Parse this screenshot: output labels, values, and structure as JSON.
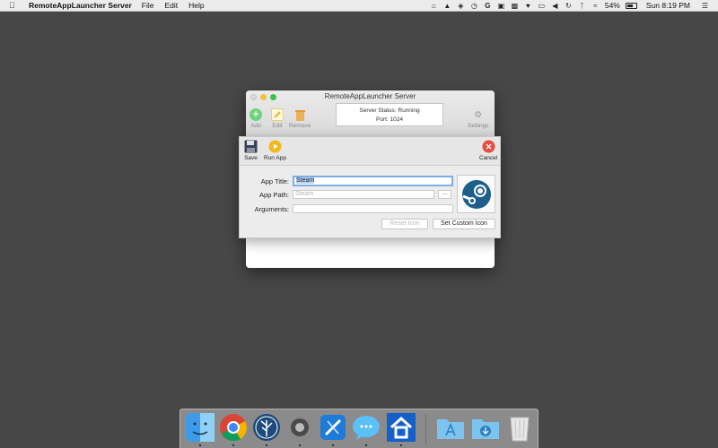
{
  "menubar": {
    "app_name": "RemoteAppLauncher Server",
    "menus": [
      "File",
      "Edit",
      "Help"
    ],
    "battery_percent": "54%",
    "clock": "Sun 8:19 PM"
  },
  "window": {
    "title": "RemoteAppLauncher Server",
    "toolbar": {
      "add_label": "Add",
      "edit_label": "Edit",
      "remove_label": "Remove",
      "settings_label": "Settings"
    },
    "status": {
      "line1": "Server Status: Running",
      "line2": "Port: 1024"
    }
  },
  "panel": {
    "save_label": "Save",
    "run_label": "Run App",
    "cancel_label": "Cancel",
    "app_title_label": "App Title:",
    "app_title_value": "Steam",
    "app_path_label": "App Path:",
    "app_path_placeholder": "Steam",
    "arguments_label": "Arguments:",
    "arguments_value": "",
    "browse_label": "...",
    "reset_icon_label": "Reset Icon",
    "set_icon_label": "Set Custom Icon"
  },
  "dock": {
    "apps": [
      "finder-icon",
      "chrome-icon",
      "sourcetree-icon",
      "system-preferences-icon",
      "xcode-icon",
      "messages-icon",
      "remote-app-launcher-icon"
    ],
    "stacks": [
      "applications-folder-icon",
      "downloads-folder-icon",
      "trash-icon"
    ]
  },
  "colors": {
    "desktop": "#474747",
    "add_green": "#45c35a",
    "run_yellow": "#f2b91c",
    "cancel_red": "#e74c3c",
    "focus_blue": "#7cadea",
    "steam_blue": "#1b5f8c"
  }
}
